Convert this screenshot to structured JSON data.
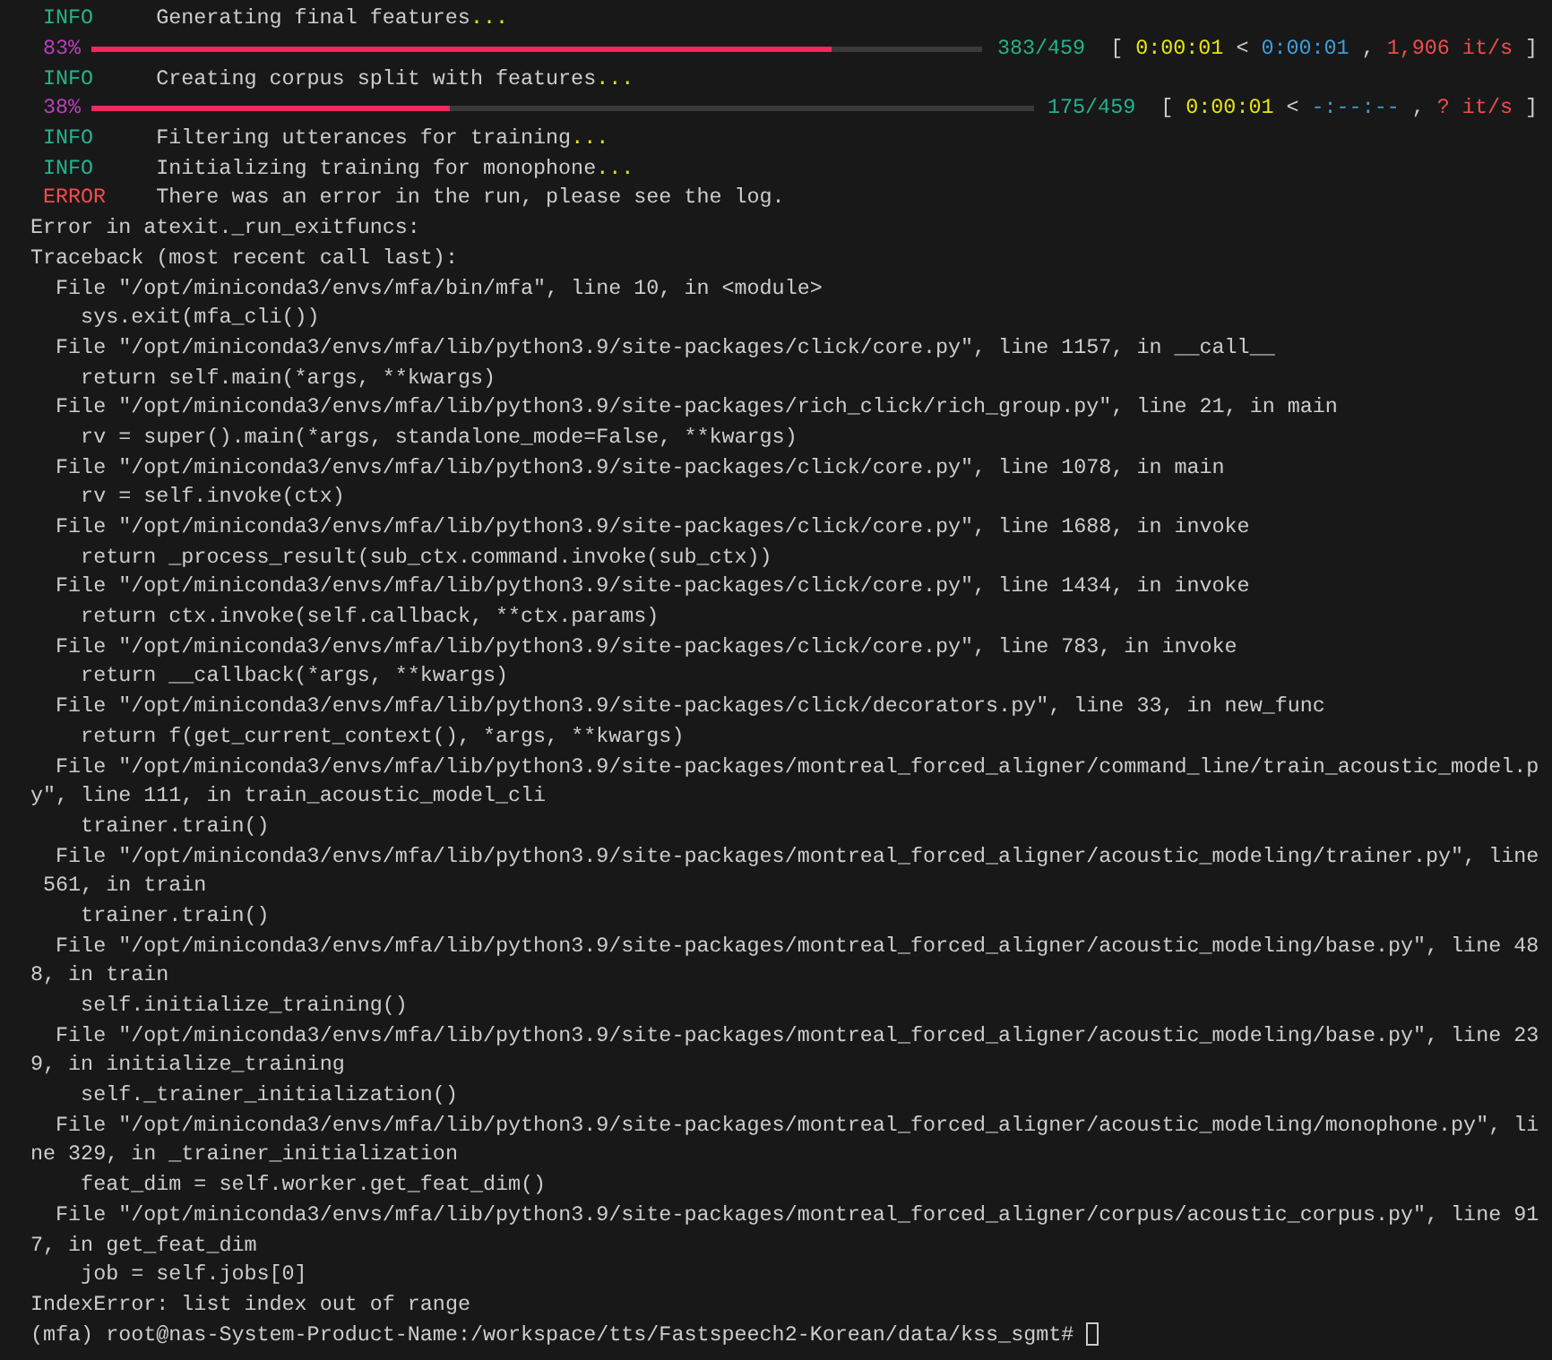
{
  "terminal": {
    "lines": [
      {
        "kind": "log",
        "color": "#23b389",
        "label": "INFO",
        "message": "Generating final features",
        "ellipsis": "..."
      },
      {
        "kind": "progress",
        "percent": "83%",
        "level": 0.83,
        "count": "383/459",
        "open": "[",
        "elapsed": "0:00:01",
        "sep": "<",
        "remaining": "0:00:01",
        "comma": ",",
        "rate": "1,906 it/s",
        "close": "]"
      },
      {
        "kind": "log",
        "color": "#23b389",
        "label": "INFO",
        "message": "Creating corpus split with features",
        "ellipsis": "..."
      },
      {
        "kind": "progress",
        "percent": "38%",
        "level": 0.38,
        "count": "175/459",
        "open": "[",
        "elapsed": "0:00:01",
        "sep": "<",
        "remaining": "-:--:--",
        "comma": ",",
        "rate": "? it/s",
        "close": "]"
      },
      {
        "kind": "log",
        "color": "#23b389",
        "label": "INFO",
        "message": "Filtering utterances for training",
        "ellipsis": "..."
      },
      {
        "kind": "log",
        "color": "#23b389",
        "label": "INFO",
        "message": "Initializing training for monophone",
        "ellipsis": "..."
      },
      {
        "kind": "log",
        "color": "#f14c4c",
        "label": "ERROR",
        "message": "There was an error in the run, please see the log."
      },
      {
        "kind": "text",
        "text": "Error in atexit._run_exitfuncs:"
      },
      {
        "kind": "text",
        "text": "Traceback (most recent call last):"
      },
      {
        "kind": "text",
        "text": "  File \"/opt/miniconda3/envs/mfa/bin/mfa\", line 10, in <module>"
      },
      {
        "kind": "text",
        "text": "    sys.exit(mfa_cli())"
      },
      {
        "kind": "text",
        "text": "  File \"/opt/miniconda3/envs/mfa/lib/python3.9/site-packages/click/core.py\", line 1157, in __call__"
      },
      {
        "kind": "text",
        "text": "    return self.main(*args, **kwargs)"
      },
      {
        "kind": "text",
        "text": "  File \"/opt/miniconda3/envs/mfa/lib/python3.9/site-packages/rich_click/rich_group.py\", line 21, in main"
      },
      {
        "kind": "text",
        "text": "    rv = super().main(*args, standalone_mode=False, **kwargs)"
      },
      {
        "kind": "text",
        "text": "  File \"/opt/miniconda3/envs/mfa/lib/python3.9/site-packages/click/core.py\", line 1078, in main"
      },
      {
        "kind": "text",
        "text": "    rv = self.invoke(ctx)"
      },
      {
        "kind": "text",
        "text": "  File \"/opt/miniconda3/envs/mfa/lib/python3.9/site-packages/click/core.py\", line 1688, in invoke"
      },
      {
        "kind": "text",
        "text": "    return _process_result(sub_ctx.command.invoke(sub_ctx))"
      },
      {
        "kind": "text",
        "text": "  File \"/opt/miniconda3/envs/mfa/lib/python3.9/site-packages/click/core.py\", line 1434, in invoke"
      },
      {
        "kind": "text",
        "text": "    return ctx.invoke(self.callback, **ctx.params)"
      },
      {
        "kind": "text",
        "text": "  File \"/opt/miniconda3/envs/mfa/lib/python3.9/site-packages/click/core.py\", line 783, in invoke"
      },
      {
        "kind": "text",
        "text": "    return __callback(*args, **kwargs)"
      },
      {
        "kind": "text",
        "text": "  File \"/opt/miniconda3/envs/mfa/lib/python3.9/site-packages/click/decorators.py\", line 33, in new_func"
      },
      {
        "kind": "text",
        "text": "    return f(get_current_context(), *args, **kwargs)"
      },
      {
        "kind": "text",
        "text": "  File \"/opt/miniconda3/envs/mfa/lib/python3.9/site-packages/montreal_forced_aligner/command_line/train_acoustic_model.p"
      },
      {
        "kind": "text",
        "text": "y\", line 111, in train_acoustic_model_cli"
      },
      {
        "kind": "text",
        "text": "    trainer.train()"
      },
      {
        "kind": "text",
        "text": "  File \"/opt/miniconda3/envs/mfa/lib/python3.9/site-packages/montreal_forced_aligner/acoustic_modeling/trainer.py\", line"
      },
      {
        "kind": "text",
        "text": " 561, in train"
      },
      {
        "kind": "text",
        "text": "    trainer.train()"
      },
      {
        "kind": "text",
        "text": "  File \"/opt/miniconda3/envs/mfa/lib/python3.9/site-packages/montreal_forced_aligner/acoustic_modeling/base.py\", line 48"
      },
      {
        "kind": "text",
        "text": "8, in train"
      },
      {
        "kind": "text",
        "text": "    self.initialize_training()"
      },
      {
        "kind": "text",
        "text": "  File \"/opt/miniconda3/envs/mfa/lib/python3.9/site-packages/montreal_forced_aligner/acoustic_modeling/base.py\", line 23"
      },
      {
        "kind": "text",
        "text": "9, in initialize_training"
      },
      {
        "kind": "text",
        "text": "    self._trainer_initialization()"
      },
      {
        "kind": "text",
        "text": "  File \"/opt/miniconda3/envs/mfa/lib/python3.9/site-packages/montreal_forced_aligner/acoustic_modeling/monophone.py\", li"
      },
      {
        "kind": "text",
        "text": "ne 329, in _trainer_initialization"
      },
      {
        "kind": "text",
        "text": "    feat_dim = self.worker.get_feat_dim()"
      },
      {
        "kind": "text",
        "text": "  File \"/opt/miniconda3/envs/mfa/lib/python3.9/site-packages/montreal_forced_aligner/corpus/acoustic_corpus.py\", line 91"
      },
      {
        "kind": "text",
        "text": "7, in get_feat_dim"
      },
      {
        "kind": "text",
        "text": "    job = self.jobs[0]"
      },
      {
        "kind": "text",
        "text": "IndexError: list index out of range"
      },
      {
        "kind": "prompt",
        "text": "(mfa) root@nas-System-Product-Name:/workspace/tts/Fastspeech2-Korean/data/kss_sgmt#"
      }
    ]
  }
}
